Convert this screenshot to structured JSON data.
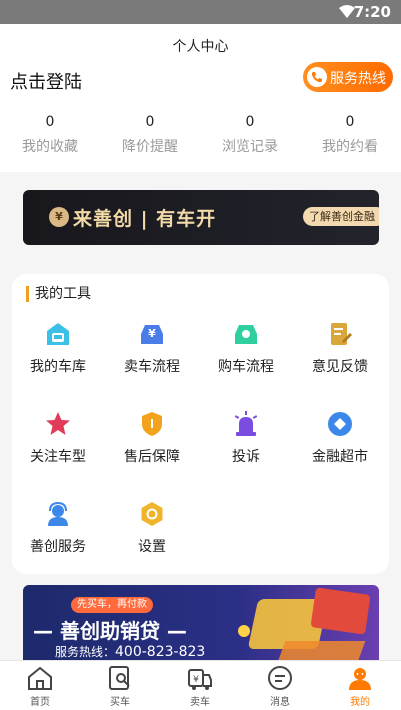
{
  "status_bar": {
    "time": "7:20"
  },
  "header": {
    "title": "个人中心"
  },
  "profile": {
    "login_label": "点击登陆",
    "hotline_label": "服务热线",
    "stats": [
      {
        "count": "0",
        "label": "我的收藏"
      },
      {
        "count": "0",
        "label": "降价提醒"
      },
      {
        "count": "0",
        "label": "浏览记录"
      },
      {
        "count": "0",
        "label": "我的约看"
      }
    ]
  },
  "banner_top": {
    "coin": "¥",
    "slogan": "来善创 | 有车开",
    "cta": "了解善创金融"
  },
  "tools": {
    "heading": "我的工具",
    "items": [
      {
        "label": "我的车库",
        "icon": "garage-icon",
        "color": "#3cc1e6"
      },
      {
        "label": "卖车流程",
        "icon": "sell-car-icon",
        "color": "#4a7de8"
      },
      {
        "label": "购车流程",
        "icon": "buy-car-icon",
        "color": "#2fcfa0"
      },
      {
        "label": "意见反馈",
        "icon": "feedback-icon",
        "color": "#d9a63a"
      },
      {
        "label": "关注车型",
        "icon": "star-icon",
        "color": "#e23b5a"
      },
      {
        "label": "售后保障",
        "icon": "shield-icon",
        "color": "#f3a21c"
      },
      {
        "label": "投诉",
        "icon": "alarm-icon",
        "color": "#7a4ce0"
      },
      {
        "label": "金融超市",
        "icon": "finance-icon",
        "color": "#3d87e8"
      },
      {
        "label": "善创服务",
        "icon": "service-icon",
        "color": "#3d87e8"
      },
      {
        "label": "设置",
        "icon": "settings-icon",
        "color": "#f0b42a"
      }
    ]
  },
  "banner_bottom": {
    "tag": "先买车，再付款",
    "headline": "— 善创助销贷 —",
    "phone_label": "服务热线：",
    "phone_number": "400-823-823"
  },
  "tabbar": {
    "active_color": "#ff7a00",
    "items": [
      {
        "label": "首页",
        "icon": "home-icon"
      },
      {
        "label": "买车",
        "icon": "buy-car-search-icon"
      },
      {
        "label": "卖车",
        "icon": "sell-car-tag-icon"
      },
      {
        "label": "消息",
        "icon": "message-icon"
      },
      {
        "label": "我的",
        "icon": "user-icon",
        "active": true
      }
    ]
  }
}
